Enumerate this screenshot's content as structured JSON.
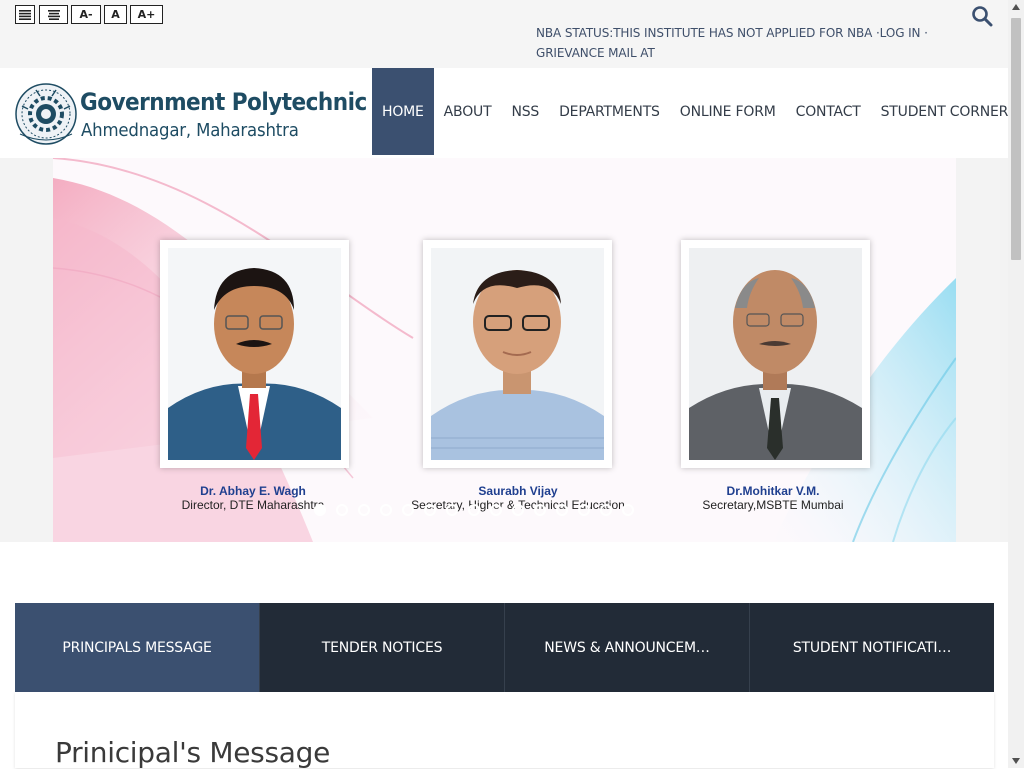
{
  "accessibility": {
    "font_decrease": "A-",
    "font_normal": "A",
    "font_increase": "A+"
  },
  "notice": {
    "line1": "NBA STATUS:THIS INSTITUTE HAS NOT APPLIED FOR NBA ·LOG IN ·",
    "line2": "GRIEVANCE MAIL AT PRINCIPAL.GPAHMEDNAGAR@DTEMAHARASHTRA.GOV.IN"
  },
  "logo": {
    "title": "Government Polytechnic",
    "subtitle": "Ahmednagar, Maharashtra"
  },
  "nav": {
    "items": [
      {
        "label": "HOME"
      },
      {
        "label": "ABOUT"
      },
      {
        "label": "NSS"
      },
      {
        "label": "DEPARTMENTS"
      },
      {
        "label": "ONLINE FORM"
      },
      {
        "label": "CONTACT"
      },
      {
        "label": "STUDENT CORNER"
      }
    ]
  },
  "slider": {
    "people": [
      {
        "name": "Dr. Abhay E. Wagh",
        "title": "Director, DTE Maharashtra"
      },
      {
        "name": "Saurabh Vijay",
        "title": "Secretary, Higher & Technical Education"
      },
      {
        "name": "Dr.Mohitkar V.M.",
        "title": "Secretary,MSBTE Mumbai"
      }
    ],
    "dot_count": 15,
    "active_dot": 0
  },
  "tabs": [
    {
      "label": "PRINCIPALS MESSAGE"
    },
    {
      "label": "TENDER NOTICES"
    },
    {
      "label": "NEWS & ANNOUNCEM…"
    },
    {
      "label": "STUDENT NOTIFICATI…"
    }
  ],
  "content": {
    "heading": "Prinicipal's Message"
  },
  "colors": {
    "nav_active": "#3b5070",
    "tab_bg": "#222b37",
    "brand_text": "#1e4c63",
    "caption_name": "#1f3f8f"
  }
}
